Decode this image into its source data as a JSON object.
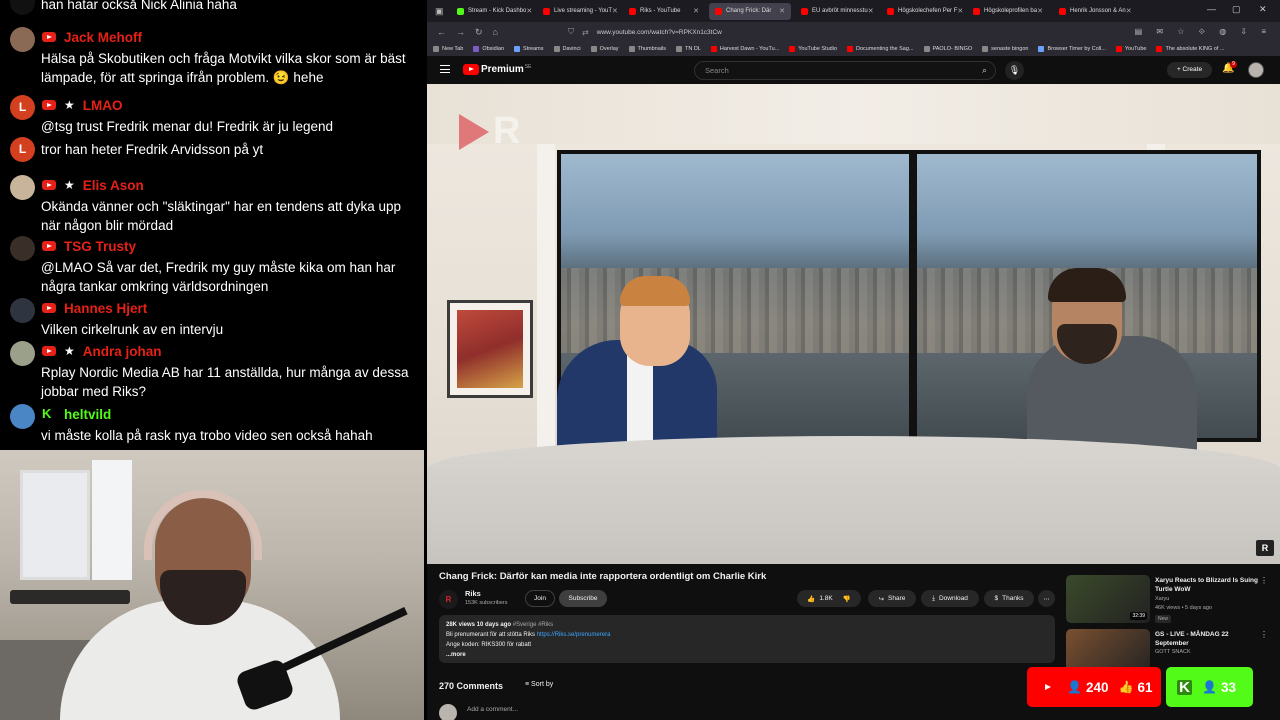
{
  "chat": {
    "messages": [
      {
        "id": "m0",
        "name": "",
        "text": "han hatar också Nick Alinia haha",
        "platform": "none",
        "avatar_color": "#111111"
      },
      {
        "id": "m1",
        "name": "Jack Mehoff",
        "text": "Hälsa på Skobutiken och fråga Motvikt vilka skor som är bäst lämpade, för att springa ifrån problem. 😉 hehe",
        "platform": "youtube",
        "star": false,
        "avatar_color": "#8a6a55"
      },
      {
        "id": "m2",
        "name": "LMAO",
        "text": "@tsg trust Fredrik menar du! Fredrik är ju legend",
        "platform": "youtube",
        "star": true,
        "avatar_letter": "L",
        "avatar_color": "#d2401f"
      },
      {
        "id": "m3",
        "name": "",
        "text": "tror han heter Fredrik Arvidsson på yt",
        "platform": "none",
        "avatar_letter": "L",
        "avatar_color": "#d2401f"
      },
      {
        "id": "m4",
        "name": "Elis Ason",
        "text": "Okända vänner och \"släktingar\" har en tendens att dyka upp när någon blir mördad",
        "platform": "youtube",
        "star": true,
        "avatar_color": "#c8b49a"
      },
      {
        "id": "m5",
        "name": "TSG Trusty",
        "text": "@LMAO Så var det, Fredrik my guy måste kika om han har några tankar omkring världsordningen",
        "platform": "youtube",
        "star": false,
        "avatar_color": "#3a2f28"
      },
      {
        "id": "m6",
        "name": "Hannes Hjert",
        "text": "Vilken cirkelrunk av en intervju",
        "platform": "youtube",
        "star": false,
        "avatar_color": "#2f3540"
      },
      {
        "id": "m7",
        "name": "Andra johan",
        "text": "Rplay Nordic Media AB har 11 anställda, hur många av dessa jobbar med Riks?",
        "platform": "youtube",
        "star": true,
        "avatar_color": "#9aa08a"
      },
      {
        "id": "m8",
        "name": "heltvild",
        "text": "vi måste kolla på rask nya trobo video sen också hahah",
        "platform": "kick",
        "star": false,
        "avatar_color": "#4a86c5"
      }
    ],
    "name_color_youtube": "#e62117",
    "name_color_kick": "#53fc18"
  },
  "browser": {
    "tabs": [
      {
        "label": "Stream - Kick Dashbo",
        "color": "#53fc18",
        "active": false
      },
      {
        "label": "Live streaming - YouT",
        "color": "#ff0000",
        "active": false
      },
      {
        "label": "Riks - YouTube",
        "color": "#ff0000",
        "active": false
      },
      {
        "label": "Chang Frick: Där",
        "color": "#ff0000",
        "active": true
      },
      {
        "label": "EU avbröt minnesstu",
        "color": "#ff0000",
        "active": false
      },
      {
        "label": "Högskolechefen Per F",
        "color": "#ff0000",
        "active": false
      },
      {
        "label": "Högskoleprofilen ba",
        "color": "#ff0000",
        "active": false
      },
      {
        "label": "Henrik Jonsson & An",
        "color": "#ff0000",
        "active": false
      }
    ],
    "url": "www.youtube.com/watch?v=RPKXn1c3tCw",
    "bookmarks": [
      {
        "label": "New Tab",
        "color": "#888888"
      },
      {
        "label": "Obsidian",
        "color": "#7c5cc4"
      },
      {
        "label": "Streams",
        "color": "#6aa1ff"
      },
      {
        "label": "Davinci",
        "color": "#888888"
      },
      {
        "label": "Overlay",
        "color": "#888888"
      },
      {
        "label": "Thumbnails",
        "color": "#888888"
      },
      {
        "label": "TN DL",
        "color": "#888888"
      },
      {
        "label": "Harvest Dawn - YouTu...",
        "color": "#ff0000"
      },
      {
        "label": "YouTube Studio",
        "color": "#ff0000"
      },
      {
        "label": "Documenting the Sag...",
        "color": "#ff0000"
      },
      {
        "label": "PAOLO- BINGO",
        "color": "#888888"
      },
      {
        "label": "senaste bingon",
        "color": "#888888"
      },
      {
        "label": "Browser Timer by Coll...",
        "color": "#6aa1ff"
      },
      {
        "label": "YouTube",
        "color": "#ff0000"
      },
      {
        "label": "The absolute KING of ...",
        "color": "#ff0000"
      }
    ]
  },
  "youtube": {
    "logo_text": "Premium",
    "logo_country": "SE",
    "search_placeholder": "Search",
    "create_label": "Create",
    "notification_count": "9",
    "video_title": "Chang Frick: Därför kan media inte rapportera ordentligt om Charlie Kirk",
    "channel": {
      "name": "Riks",
      "subscribers": "153K subscribers",
      "avatar_letter": "R"
    },
    "join_label": "Join",
    "subscribe_label": "Subscribe",
    "likes": "1.8K",
    "share_label": "Share",
    "download_label": "Download",
    "thanks_label": "Thanks",
    "description": {
      "stats": "28K views  10 days ago",
      "tags": "#Sverige #Riks",
      "line1": "Bli prenumerant för att stötta Riks ",
      "link": "https://Riks.se/prenumerera",
      "line2": "Ange koden: RIKS300 för rabatt",
      "more": "...more"
    },
    "comments_count": "270 Comments",
    "sort_label": "Sort by",
    "add_comment_placeholder": "Add a comment...",
    "recommendations": [
      {
        "title": "Xaryu Reacts to Blizzard Is Suing Turtle WoW",
        "channel": "Xaryu",
        "meta": "46K views • 5 days ago",
        "badge": "New",
        "duration": "32:39",
        "thumb_color": "#3b4a2a"
      },
      {
        "title": "GS - LIVE - MÅNDAG 22 September",
        "channel": "GOTT SNACK",
        "meta": "",
        "badge": "",
        "duration": "",
        "thumb_color": "#7a5030"
      }
    ]
  },
  "overlay": {
    "youtube_viewers": "240",
    "youtube_likes": "61",
    "kick_viewers": "33",
    "youtube_color": "#ff0000",
    "kick_color": "#53fc18"
  }
}
